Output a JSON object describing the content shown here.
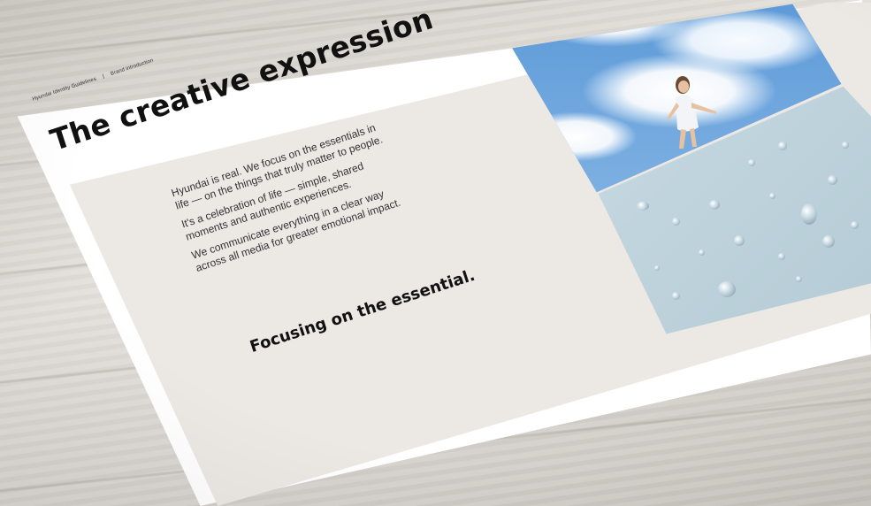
{
  "document": {
    "breadcrumb": {
      "left": "Hyundai Identity Guidelines",
      "separator": "|",
      "right": "Brand introduction"
    },
    "title": "The creative expression",
    "paragraphs": [
      "Hyundai is real. We focus on the essentials in",
      "life — on the things that truly matter to people.",
      "It's a celebration of life — simple, shared",
      "moments and authentic experiences.",
      "We communicate everything in a clear way",
      "across all media for greater emotional impact."
    ],
    "tagline": "Focusing on the essential."
  },
  "colors": {
    "panel": "#ece8e4",
    "sheet": "#ffffff",
    "text": "#111111"
  }
}
